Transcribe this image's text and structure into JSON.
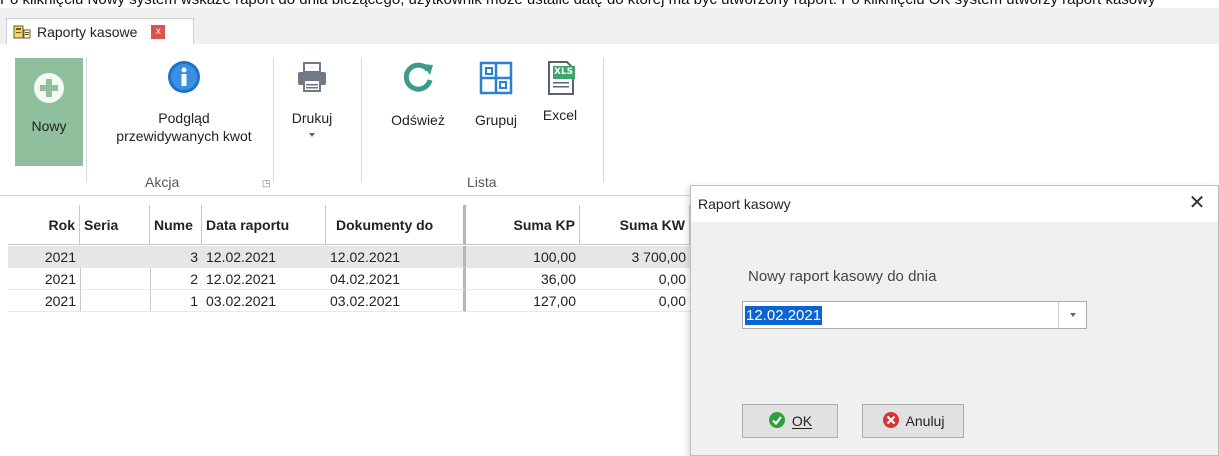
{
  "top_caption": "Po kliknięciu Nowy system wskaże raport do dnia bieżącego, użytkownik może ustalić datę do której ma być utworzony raport. Po kliknięciu OK system utworzy raport kasowy",
  "tab": {
    "title": "Raporty kasowe",
    "close_glyph": "x"
  },
  "ribbon": {
    "new_label": "Nowy",
    "preview_label_1": "Podgląd",
    "preview_label_2": "przewidywanych kwot",
    "print_label": "Drukuj",
    "refresh_label": "Odśwież",
    "group_label": "Grupuj",
    "excel_label": "Excel",
    "excel_badge": "XLS",
    "group_akcja": "Akcja",
    "group_lista": "Lista"
  },
  "grid": {
    "headers": [
      "Rok",
      "Seria",
      "Nume",
      "Data raportu",
      "Dokumenty do",
      "Suma KP",
      "Suma KW"
    ],
    "rows": [
      [
        "2021",
        "",
        "3",
        "12.02.2021",
        "12.02.2021",
        "100,00",
        "3 700,00"
      ],
      [
        "2021",
        "",
        "2",
        "12.02.2021",
        "04.02.2021",
        "36,00",
        "0,00"
      ],
      [
        "2021",
        "",
        "1",
        "03.02.2021",
        "03.02.2021",
        "127,00",
        "0,00"
      ]
    ]
  },
  "dialog": {
    "title": "Raport kasowy",
    "close_glyph": "✕",
    "prompt": "Nowy raport kasowy do dnia",
    "date_value": "12.02.2021",
    "ok_label": "OK",
    "cancel_label": "Anuluj"
  },
  "colors": {
    "new_button_bg": "#8fbf9c",
    "selection": "#0a64d2",
    "ok_icon": "#2e9e3e",
    "cancel_icon": "#d93434",
    "refresh": "#3c9a8a",
    "info": "#1a73c9"
  }
}
